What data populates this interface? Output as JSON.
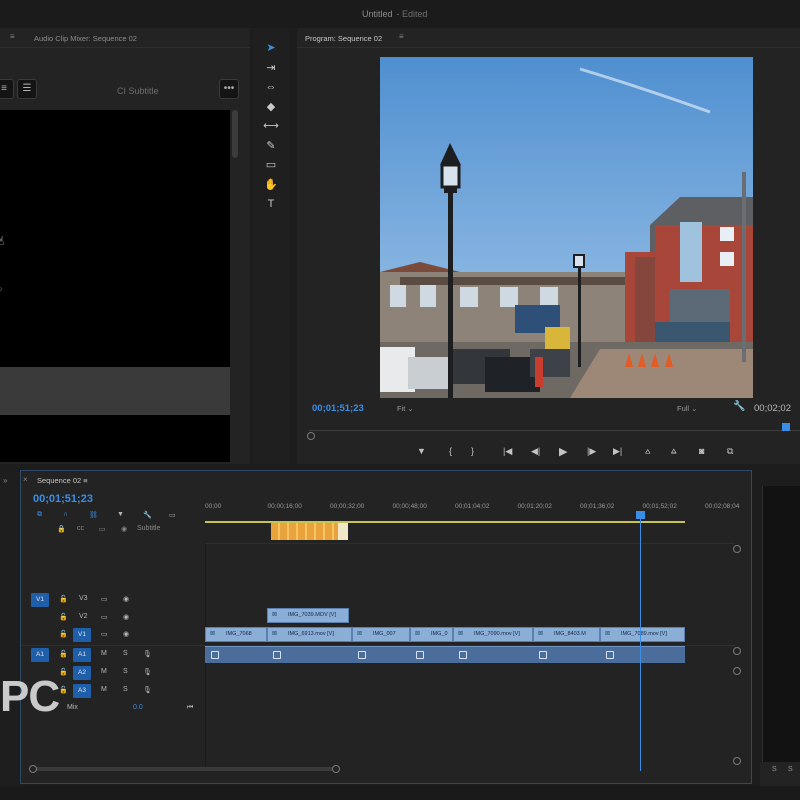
{
  "window": {
    "title": "Untitled",
    "status": "- Edited"
  },
  "source_panel": {
    "tab_active": "",
    "tab_audio_mixer": "Audio Clip Mixer: Sequence 02",
    "subtitle_label": "CI Subtitle",
    "more_label": "•••"
  },
  "program": {
    "tab": "Program: Sequence 02",
    "tc_left": "00;01;51;23",
    "fit": "Fit",
    "full": "Full",
    "tc_right": "00;02;02"
  },
  "timeline": {
    "tab": "Sequence 02",
    "timecode": "00;01;51;23",
    "subtitle_row": "Subtitle",
    "ruler_labels": [
      "00;00",
      "00;00;16;00",
      "00;00;32;00",
      "00;00;48;00",
      "00;01;04;02",
      "00;01;20;02",
      "00;01;36;02",
      "00;01;52;02",
      "00;02;08;04"
    ],
    "tracks": {
      "v3": "V3",
      "v2": "V2",
      "v1": "V1",
      "a1": "A1",
      "a2": "A2",
      "a3": "A3",
      "mix": "Mix",
      "mix_value": "0.0",
      "src_v1": "V1",
      "src_a1": "A1"
    },
    "clips_v2": [
      {
        "name": "IMG_7039.MOV [V]"
      }
    ],
    "clips_v1": [
      {
        "name": "IMG_7068"
      },
      {
        "name": "IMG_6913.mov [V]"
      },
      {
        "name": "IMG_007"
      },
      {
        "name": "IMG_0"
      },
      {
        "name": "IMG_7090.mov [V]"
      },
      {
        "name": "IMG_8403.M"
      },
      {
        "name": "IMG_7089.mov [V]"
      }
    ]
  },
  "watermark": "PC",
  "colors": {
    "accent": "#3a8ee6",
    "clip_video": "#8aaed6",
    "clip_audio": "#4a6d9c",
    "render_bar": "#e8a33a"
  }
}
